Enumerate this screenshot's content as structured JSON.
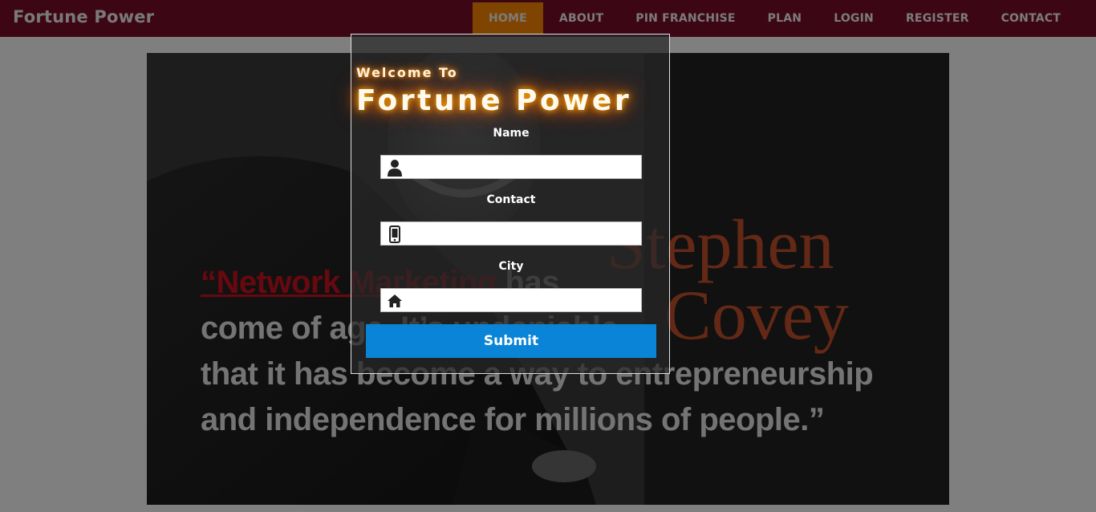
{
  "brand": "Fortune Power",
  "nav": {
    "items": [
      "HOME",
      "ABOUT",
      "PIN FRANCHISE",
      "PLAN",
      "LOGIN",
      "REGISTER",
      "CONTACT"
    ],
    "active": "HOME"
  },
  "hero": {
    "quote_red": "“Network Marketing",
    "quote_line1_rest": " has",
    "quote_line2": "come of age. It’s undeniable",
    "quote_line3": "that it has become a way to entrepreneurship",
    "quote_line4": "and independence for millions of people.”",
    "signature_line1": "Stephen",
    "signature_line2": "Covey"
  },
  "modal": {
    "welcome": "Welcome To",
    "title": "Fortune Power",
    "name_label": "Name",
    "contact_label": "Contact",
    "city_label": "City",
    "name_value": "",
    "contact_value": "",
    "city_value": "",
    "submit_label": "Submit"
  },
  "icons": {
    "name": "user-icon",
    "contact": "mobile-phone-icon",
    "city": "home-icon"
  },
  "colors": {
    "navbar": "#7a0d2b",
    "active_nav": "#ff8a00",
    "submit": "#0a84d6",
    "quote_red": "#d0101e",
    "signature": "#c9502c"
  }
}
